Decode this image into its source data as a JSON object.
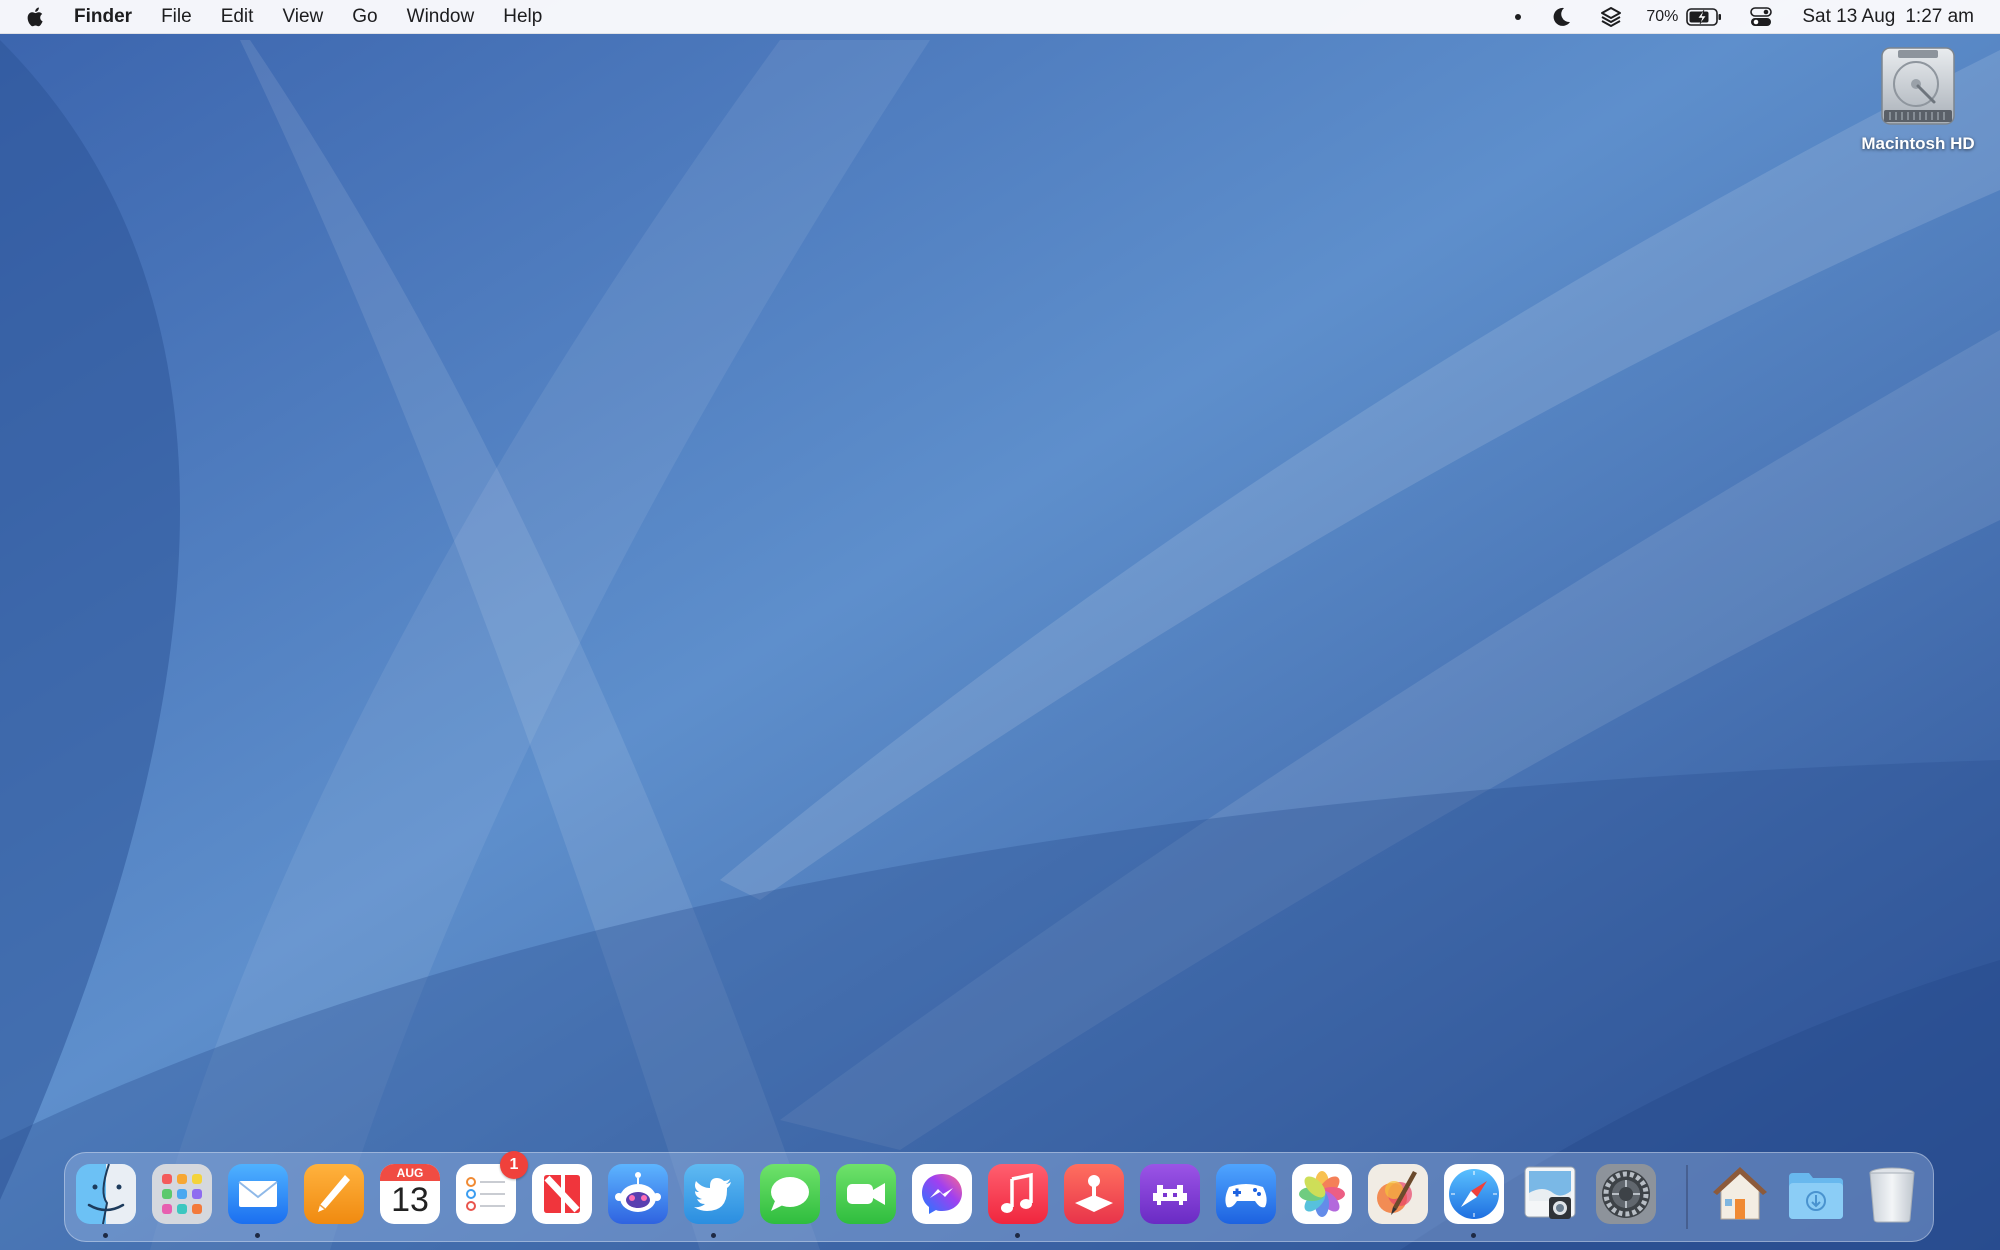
{
  "menubar": {
    "app_name": "Finder",
    "menus": [
      "File",
      "Edit",
      "View",
      "Go",
      "Window",
      "Help"
    ],
    "status": {
      "battery_percent": "70%",
      "date": "Sat 13 Aug",
      "time": "1:27 am"
    },
    "icons": [
      "apple-icon",
      "dot-icon",
      "moon-icon",
      "layers-icon",
      "battery-icon",
      "control-center-icon"
    ]
  },
  "desktop": {
    "icons": [
      {
        "label": "Macintosh HD",
        "icon": "hard-drive-icon"
      }
    ]
  },
  "dock": {
    "items": [
      {
        "name": "finder",
        "running": true
      },
      {
        "name": "launchpad",
        "running": false
      },
      {
        "name": "mail",
        "running": true
      },
      {
        "name": "pages",
        "running": false
      },
      {
        "name": "calendar",
        "running": false,
        "month": "AUG",
        "day": "13"
      },
      {
        "name": "reminders",
        "running": false,
        "badge": "1"
      },
      {
        "name": "news",
        "running": false
      },
      {
        "name": "reddit-client",
        "running": false
      },
      {
        "name": "twitter",
        "running": true
      },
      {
        "name": "messages",
        "running": false
      },
      {
        "name": "facetime",
        "running": false
      },
      {
        "name": "messenger",
        "running": false
      },
      {
        "name": "music",
        "running": true
      },
      {
        "name": "arcade",
        "running": false
      },
      {
        "name": "game-emulator",
        "running": false
      },
      {
        "name": "game-controller",
        "running": false
      },
      {
        "name": "photos",
        "running": false
      },
      {
        "name": "pixelmator",
        "running": false
      },
      {
        "name": "safari",
        "running": true
      },
      {
        "name": "preview",
        "running": false
      },
      {
        "name": "system-preferences",
        "running": false
      },
      {
        "name": "home-folder",
        "running": false
      },
      {
        "name": "downloads-folder",
        "running": false
      },
      {
        "name": "trash",
        "running": false
      }
    ]
  },
  "colors": {
    "wallpaper_dark": "#2b4f92",
    "wallpaper_light": "#6f9fd6",
    "badge": "#f0413b"
  }
}
